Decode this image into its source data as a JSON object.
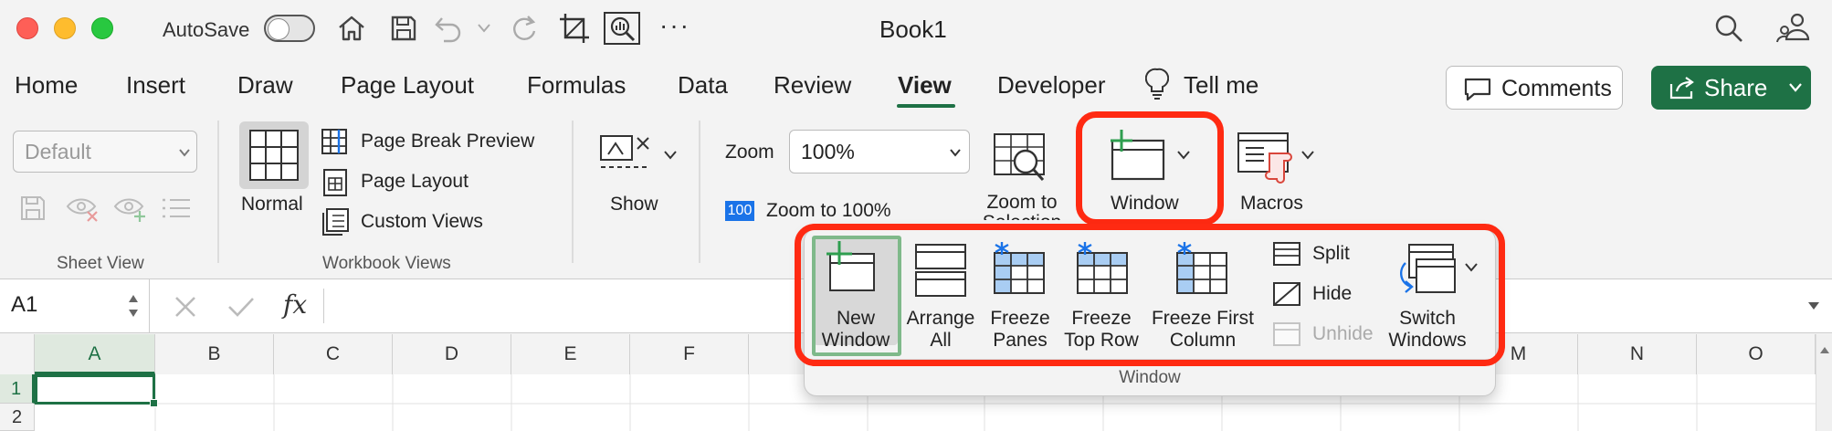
{
  "window": {
    "title": "Book1",
    "autosave_label": "AutoSave"
  },
  "tabs": [
    "Home",
    "Insert",
    "Draw",
    "Page Layout",
    "Formulas",
    "Data",
    "Review",
    "View",
    "Developer"
  ],
  "tell_me": "Tell me",
  "buttons": {
    "comments": "Comments",
    "share": "Share"
  },
  "sheet_view": {
    "style_value": "Default",
    "group_label": "Sheet View"
  },
  "workbook_views": {
    "normal": "Normal",
    "page_break_preview": "Page Break Preview",
    "page_layout": "Page Layout",
    "custom_views": "Custom Views",
    "group_label": "Workbook Views"
  },
  "show": {
    "label": "Show"
  },
  "zoom": {
    "label": "Zoom",
    "value": "100%",
    "zoom_100_icon": "100",
    "zoom_to_100": "Zoom to 100%",
    "zoom_to_selection": "Zoom to Selection"
  },
  "window_group": {
    "label": "Window"
  },
  "macros": {
    "label": "Macros"
  },
  "formula_bar": {
    "name_box": "A1",
    "fx": "fx"
  },
  "columns": [
    "A",
    "B",
    "C",
    "D",
    "E",
    "F",
    "M",
    "N",
    "O"
  ],
  "rows": [
    "1",
    "2"
  ],
  "window_panel": {
    "new_window": [
      "New",
      "Window"
    ],
    "arrange_all": [
      "Arrange",
      "All"
    ],
    "freeze_panes": [
      "Freeze",
      "Panes"
    ],
    "freeze_top_row": [
      "Freeze",
      "Top Row"
    ],
    "freeze_first_column": [
      "Freeze First",
      "Column"
    ],
    "split": "Split",
    "hide": "Hide",
    "unhide": "Unhide",
    "switch_windows": [
      "Switch",
      "Windows"
    ],
    "group_label": "Window"
  },
  "colors": {
    "accent": "#1e7145",
    "highlight": "#ff2a12",
    "freeze_blue": "#1a73e8"
  }
}
